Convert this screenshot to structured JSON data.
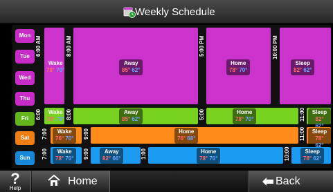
{
  "header": {
    "title": "Weekly Schedule",
    "icon": "calendar-clock-icon"
  },
  "days": [
    "Mon",
    "Tue",
    "Wed",
    "Thu",
    "Fri",
    "Sat",
    "Sun"
  ],
  "weekday": {
    "wake": {
      "label": "Wake",
      "heat": "78°",
      "cool": "70°",
      "time": "6:00 AM"
    },
    "away": {
      "label": "Away",
      "heat": "85°",
      "cool": "62°",
      "time": "8:00 AM"
    },
    "home": {
      "label": "Home",
      "heat": "78°",
      "cool": "70°",
      "time": "5:00 PM"
    },
    "sleep": {
      "label": "Sleep",
      "heat": "82°",
      "cool": "62°",
      "time": "10:00 PM"
    }
  },
  "friday": {
    "wake": {
      "label": "Wake",
      "heat": "78°",
      "cool": "70°",
      "time": "6:00"
    },
    "away": {
      "label": "Away",
      "heat": "85°",
      "cool": "62°",
      "time": "8:00"
    },
    "home": {
      "label": "Home",
      "heat": "78°",
      "cool": "70°",
      "time": "5:00"
    },
    "sleep": {
      "label": "Sleep",
      "heat": "82°",
      "cool": "62°",
      "time": "11:00"
    }
  },
  "saturday": {
    "wake": {
      "label": "Wake",
      "heat": "76°",
      "cool": "70°",
      "time": "7:00"
    },
    "home": {
      "label": "Home",
      "heat": "76°",
      "cool": "68°",
      "time": "9:00"
    },
    "sleep": {
      "label": "Sleep",
      "heat": "78°",
      "cool": "62°",
      "time": "11:00"
    }
  },
  "sunday": {
    "wake": {
      "label": "Wake",
      "heat": "78°",
      "cool": "70°",
      "time": "7:00"
    },
    "away": {
      "label": "Away",
      "heat": "82°",
      "cool": "66°",
      "time": "9:00"
    },
    "home": {
      "label": "Home",
      "heat": "78°",
      "cool": "70°",
      "time": "1:00"
    },
    "sleep": {
      "label": "Sleep",
      "heat": "78°",
      "cool": "62°",
      "time": "10:00"
    }
  },
  "footer": {
    "help": "Help",
    "home": "Home",
    "back": "Back"
  },
  "colors": {
    "weekday": "#cc33cc",
    "friday": "#78d321",
    "saturday": "#ff8c1a",
    "sunday": "#1b9cf2",
    "label_bg": "#2c2c2c",
    "heat": "#ff6b6b",
    "cool": "#6aa6ff"
  }
}
